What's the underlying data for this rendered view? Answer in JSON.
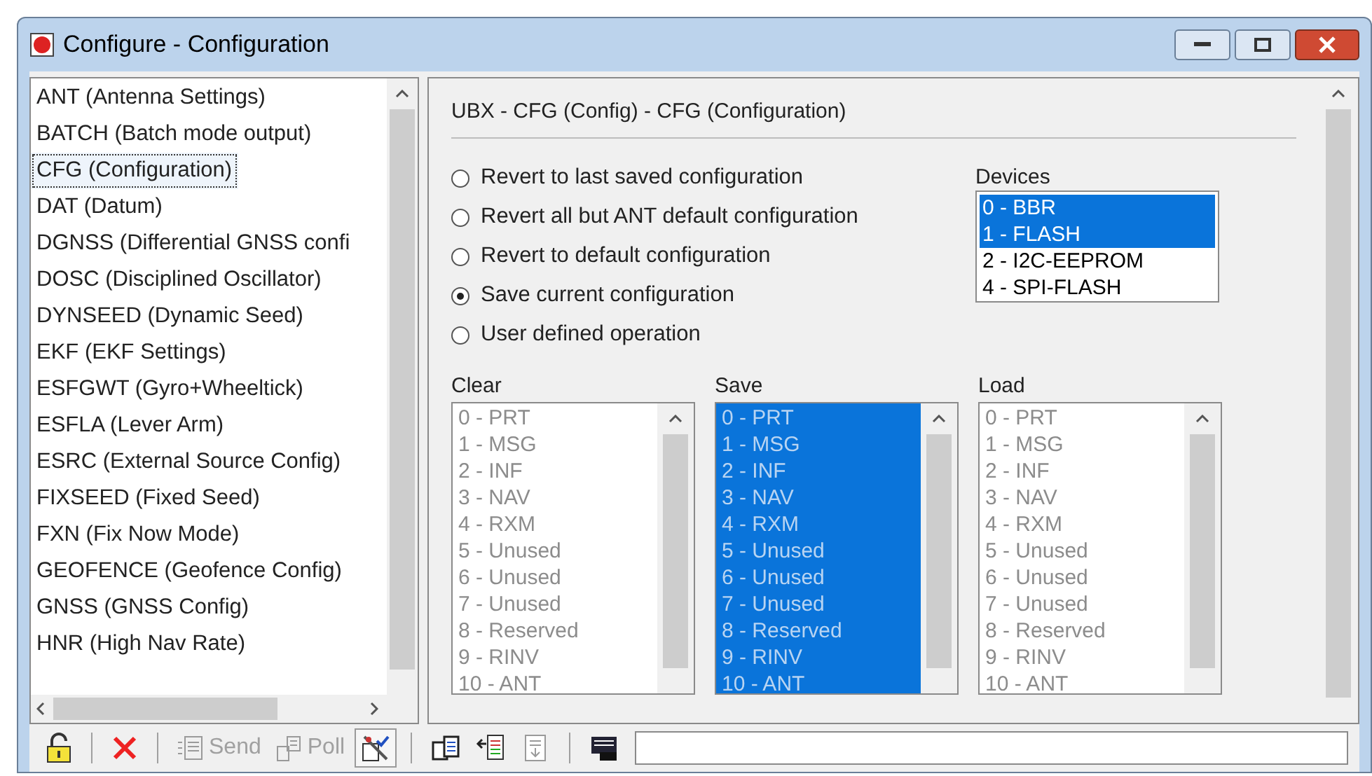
{
  "window": {
    "title": "Configure - Configuration"
  },
  "sidebar": {
    "items": [
      {
        "label": "ANT (Antenna Settings)",
        "selected": false
      },
      {
        "label": "BATCH (Batch mode output)",
        "selected": false
      },
      {
        "label": "CFG (Configuration)",
        "selected": true
      },
      {
        "label": "DAT (Datum)",
        "selected": false
      },
      {
        "label": "DGNSS (Differential GNSS confi",
        "selected": false
      },
      {
        "label": "DOSC (Disciplined Oscillator)",
        "selected": false
      },
      {
        "label": "DYNSEED (Dynamic Seed)",
        "selected": false
      },
      {
        "label": "EKF (EKF Settings)",
        "selected": false
      },
      {
        "label": "ESFGWT (Gyro+Wheeltick)",
        "selected": false
      },
      {
        "label": "ESFLA (Lever Arm)",
        "selected": false
      },
      {
        "label": "ESRC (External Source Config)",
        "selected": false
      },
      {
        "label": "FIXSEED (Fixed Seed)",
        "selected": false
      },
      {
        "label": "FXN (Fix Now Mode)",
        "selected": false
      },
      {
        "label": "GEOFENCE (Geofence Config)",
        "selected": false
      },
      {
        "label": "GNSS (GNSS Config)",
        "selected": false
      },
      {
        "label": "HNR (High Nav Rate)",
        "selected": false
      }
    ]
  },
  "panel": {
    "heading": "UBX - CFG (Config) - CFG (Configuration)",
    "options": [
      {
        "label": "Revert to last saved configuration",
        "selected": false
      },
      {
        "label": "Revert all but ANT default configuration",
        "selected": false
      },
      {
        "label": "Revert to default configuration",
        "selected": false
      },
      {
        "label": "Save current configuration",
        "selected": true
      },
      {
        "label": "User defined operation",
        "selected": false
      }
    ],
    "devices": {
      "label": "Devices",
      "items": [
        {
          "label": "0 - BBR",
          "selected": true
        },
        {
          "label": "1 - FLASH",
          "selected": true
        },
        {
          "label": "2 - I2C-EEPROM",
          "selected": false
        },
        {
          "label": "4 - SPI-FLASH",
          "selected": false
        }
      ]
    },
    "masks": [
      {
        "label": "Clear",
        "disabled": true,
        "items": [
          {
            "label": "0 - PRT",
            "selected": false
          },
          {
            "label": "1 - MSG",
            "selected": false
          },
          {
            "label": "2 - INF",
            "selected": false
          },
          {
            "label": "3 - NAV",
            "selected": false
          },
          {
            "label": "4 - RXM",
            "selected": false
          },
          {
            "label": "5 - Unused",
            "selected": false
          },
          {
            "label": "6 - Unused",
            "selected": false
          },
          {
            "label": "7 - Unused",
            "selected": false
          },
          {
            "label": "8 - Reserved",
            "selected": false
          },
          {
            "label": "9 - RINV",
            "selected": false
          },
          {
            "label": "10 - ANT",
            "selected": false
          }
        ]
      },
      {
        "label": "Save",
        "disabled": true,
        "items": [
          {
            "label": "0 - PRT",
            "selected": true
          },
          {
            "label": "1 - MSG",
            "selected": true
          },
          {
            "label": "2 - INF",
            "selected": true
          },
          {
            "label": "3 - NAV",
            "selected": true
          },
          {
            "label": "4 - RXM",
            "selected": true
          },
          {
            "label": "5 - Unused",
            "selected": true
          },
          {
            "label": "6 - Unused",
            "selected": true
          },
          {
            "label": "7 - Unused",
            "selected": true
          },
          {
            "label": "8 - Reserved",
            "selected": true
          },
          {
            "label": "9 - RINV",
            "selected": true
          },
          {
            "label": "10 - ANT",
            "selected": true
          }
        ]
      },
      {
        "label": "Load",
        "disabled": true,
        "items": [
          {
            "label": "0 - PRT",
            "selected": false
          },
          {
            "label": "1 - MSG",
            "selected": false
          },
          {
            "label": "2 - INF",
            "selected": false
          },
          {
            "label": "3 - NAV",
            "selected": false
          },
          {
            "label": "4 - RXM",
            "selected": false
          },
          {
            "label": "5 - Unused",
            "selected": false
          },
          {
            "label": "6 - Unused",
            "selected": false
          },
          {
            "label": "7 - Unused",
            "selected": false
          },
          {
            "label": "8 - Reserved",
            "selected": false
          },
          {
            "label": "9 - RINV",
            "selected": false
          },
          {
            "label": "10 - ANT",
            "selected": false
          }
        ]
      }
    ]
  },
  "toolbar": [
    {
      "kind": "lock"
    },
    {
      "kind": "separator"
    },
    {
      "kind": "delete"
    },
    {
      "kind": "separator"
    },
    {
      "kind": "send",
      "label": "Send",
      "disabled": true
    },
    {
      "kind": "poll",
      "label": "Poll",
      "disabled": true
    },
    {
      "kind": "tools",
      "pressed": true
    },
    {
      "kind": "separator"
    },
    {
      "kind": "copy"
    },
    {
      "kind": "import"
    },
    {
      "kind": "export",
      "disabled": true
    },
    {
      "kind": "separator"
    },
    {
      "kind": "monitor"
    },
    {
      "kind": "status"
    }
  ]
}
